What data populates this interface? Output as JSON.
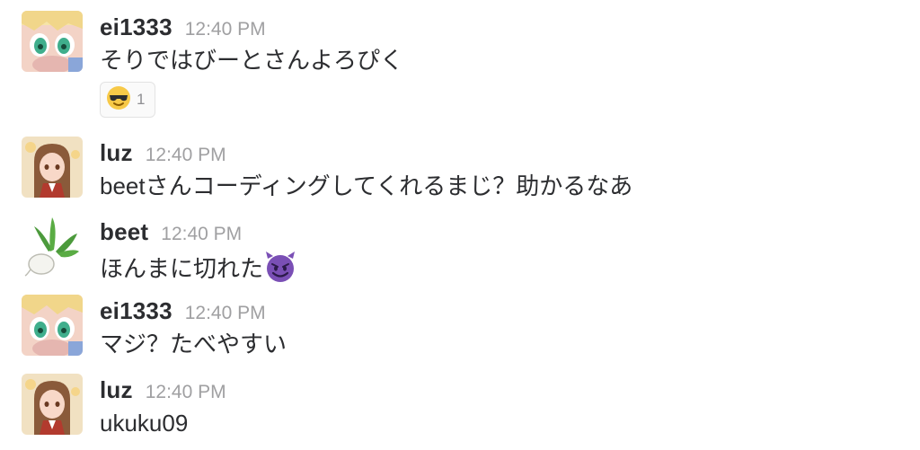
{
  "messages": [
    {
      "user": "ei1333",
      "time": "12:40 PM",
      "text": "そりではびーとさんよろぴく",
      "reaction": {
        "emoji": "sunglasses-face",
        "count": "1"
      }
    },
    {
      "user": "luz",
      "time": "12:40 PM",
      "text": "beetさんコーディングしてくれるまじ？助かるなあ"
    },
    {
      "user": "beet",
      "time": "12:40 PM",
      "text": "ほんまに切れた",
      "emoji": "smiling-imp"
    },
    {
      "user": "ei1333",
      "time": "12:40 PM",
      "text": "マジ？たべやすい"
    },
    {
      "user": "luz",
      "time": "12:40 PM",
      "text": "ukuku09"
    }
  ],
  "colors": {
    "username": "#2c2d30",
    "timestamp": "#a0a0a2",
    "text": "#2c2d30",
    "imp": "#7a4fb5"
  }
}
